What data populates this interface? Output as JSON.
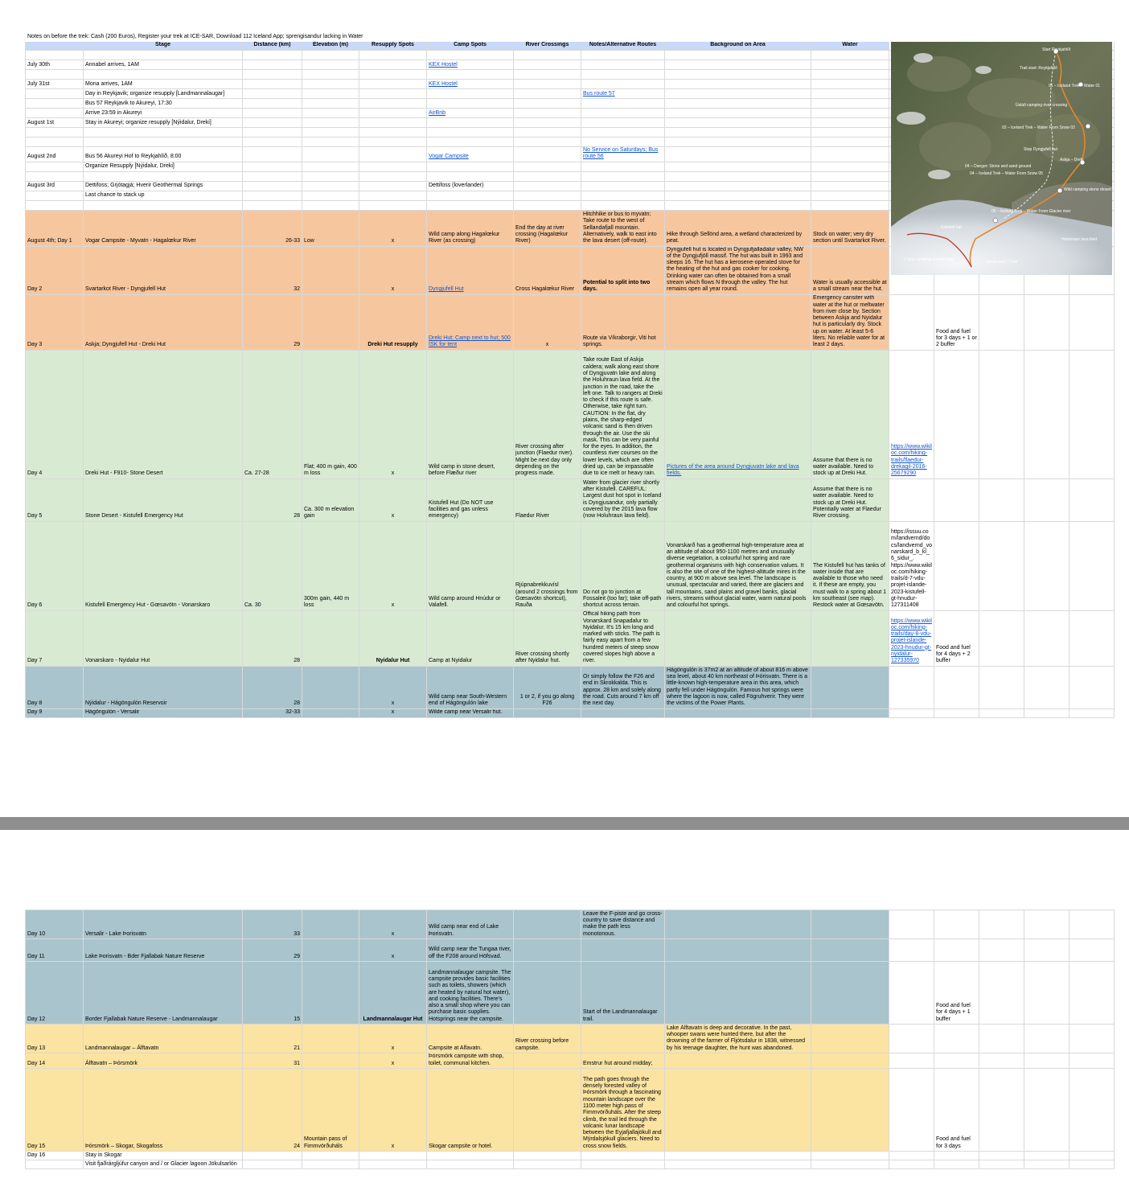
{
  "notes": "Notes on before the trek: Cash (200 Euros), Register your trek at ICE-SAR, Download 112 Iceland App; sprengisandur lacking in Water",
  "headers": [
    "",
    "Stage",
    "Distance (km)",
    "Elevation (m)",
    "Resupply Spots",
    "Camp Spots",
    "River Crossings",
    "Notes/Alternative Routes",
    "Background on Area",
    "Water"
  ],
  "pre": {
    "r1": {
      "date": "July 30th",
      "stage": "Annabel arrives, 1AM",
      "camp": "KEX Hostel"
    },
    "r2": {
      "date": "July 31st",
      "stage": "Mona arrives, 1AM",
      "camp": "KEX Hostel"
    },
    "r3": {
      "stage": "Day in Reykjavik; organize resupply [Landmannalaugar]",
      "notes": "Bus route 57"
    },
    "r4": {
      "stage": "Bus 57 Reykjavik to Akureyi, 17:30"
    },
    "r5": {
      "stage": "Arrive 23:59 in Akureyi",
      "camp": "AirBnb"
    },
    "r6": {
      "date": "August 1st",
      "stage": "Stay in Akureyi; organize resupply [Nýidalur, Dreki]"
    },
    "r7": {
      "date": "August 2nd",
      "stage": "Bus 56 Akureyi Hof to Reykjahlíð, 8:00",
      "camp": "Vogar Campsite",
      "notes": "No Service on Saturdays; Bus route 56"
    },
    "r8": {
      "stage": "Organize Resupply  [Nýidalur, Dreki]"
    },
    "r9": {
      "date": "August 3rd",
      "stage": "Dettifoss; Grjótagjá; Hverir Geothermal Springs",
      "camp": "Dettifoss (loverlander)"
    },
    "r10": {
      "stage": "Last chance to stack up"
    }
  },
  "days": {
    "d1": {
      "date": "August 4th; Day 1",
      "stage": "Vogar Campsite - Myvatn - Hagalœkur River",
      "dist": "26-33",
      "elev": "Low",
      "res": "x",
      "camp": "Wild camp along Hagalœkur River (as crossing)",
      "river": "End the day at river crossing (Hagalœkur River)",
      "notes": "Hitchhike or bus to myvatn; Take route to the west of Sellandafjall mountain. Alternatively, walk to east into the lava desert (off-route).",
      "bg": "Hike through Sellönd area, a wetland characterized by peat.",
      "water": "Stock on water; very dry section until Svartarkot River."
    },
    "d2": {
      "date": "Day 2",
      "stage": "Svartarkot River - Dyngjufell Hut",
      "dist": "32",
      "res": "x",
      "camp": "Dyngjufell Hut",
      "river": "Cross Hagalœkur River",
      "notes": "Potential to split into two days.",
      "bg": "Dyngjufell hut is located in Dyngjufjalladalur valley, NW of the Dyngjufjöll massif. The hut was built in 1993 and sleeps 16. The hut has a kerosene-operated stove for the heating of the hut and gas cooker for cooking. Drinking water can often be obtained from a small stream which flows N through the valley. The hut remains open all year round.",
      "water": "Water is usually accessible at a small stream near the hut."
    },
    "d3": {
      "date": "Day 3",
      "stage": "Askja; Dyngjufell Hut - Dreki Hut",
      "dist": "29",
      "res": "Dreki Hut resupply",
      "camp": "Dreki Hut; Camp next to hut; 500 ISK for tent",
      "river": "x",
      "notes": "Route via Víkraborgir, Viti hot springs.",
      "water": "Emergency cansiter with water at the hut or meltwater from river close by. Section between Askja and Nyidalur hut is particularly dry. Stock up on water. At least 5-6 liters. No reliable water for at least 2 days.",
      "food": "Food and fuel for 3 days + 1 or 2 buffer"
    },
    "d4": {
      "date": "Day 4",
      "stage": "Dreki Hut - F910- Stone Desert",
      "dist": "Ca. 27-28",
      "elev": "Flat; 400 m gain, 400 m loss",
      "res": "x",
      "camp": "Wild camp in stone desert, before Flæður river",
      "river": "River crossing after junction (Flaedur river). Might be next day only depending on the progress made.",
      "notes": "Take route East of Askja caldera; walk along east shore of Dyngjuvatn lake and along the Holuhraun lava field. At the junction in the road, take the left one. Talk to rangers at Dreki to check if this route is safe. Otherwise, take right turn. CAUTION: In the flat, dry plains, the sharp-edged volcanic sand is then driven through the air. Use the ski mask. This can be very painful for the eyes. In addition, the countless river courses on the lower levels, which are often dried up, can be impassable due to ice melt or heavy rain.",
      "bg": "Pictures of the area around Dyngjuvatn lake and lava fields.",
      "water": "Assume that there is no water available. Need to stock up at Dreki Hut.",
      "link": "https://www.wikiloc.com/hiking-trails/flaedur-drekagil-2016-25679290"
    },
    "d5": {
      "date": "Day 5",
      "stage": "Stone Desert - Kistufell Emergency Hut",
      "dist": "28",
      "elev": "Ca. 300 m elevation gain",
      "res": "x",
      "camp": "Kistufell Hut (Do NOT use facilities and gas unless emergency)",
      "river": "Flaedur River",
      "notes": "Water from glacier river shortly after Kistufell. CAREFUL: Largest dust hot spot in Iceland is Dyngjusandur, only partially covered by the 2015 lava flow (now Holuhraun lava field).",
      "water": "Assume that there is no water available. Need to stock up at Dreki Hut. Potentially water at Flaedur River crossing."
    },
    "d6": {
      "date": "Day 6",
      "stage": "Kistufell Emergency Hut - Gœsavötn - Vonarskaro",
      "dist": "Ca. 30",
      "elev": "300m gain, 440 m loss",
      "res": "x",
      "camp": "Wild camp around Hnúdur or Valafell.",
      "river": "Rjúpnabrekkuvísl (around 2 crossings from Gœsavötn shortcut), Rauða",
      "notes": "Do not go to junction at Fossaleit (too far); take off-path shortcut across terrain.",
      "bg": "Vonarskarð has a geothermal high-temperature area at an altitude of about 950-1100 metres and unusually diverse vegetation, a colourful hot spring and rare geothermal organisms with high conservation values. It is also the site of one of the highest-altitude mires in the country, at 900 m above sea level. The landscape is unusual, spectacular and varied, there are glaciers and tall mountains, sand plains and gravel banks, glacial rivers, streams without glacial water, warm natural pools and colourful hot springs.",
      "water": "The Kistufell hut has tanks of water inside that are available to those who need it. If these are empty, you must walk to a spring about 1 km southeast (see map). Restock water at Gœsavötn.",
      "link": "https://issuu.com/landvernd/docs/landvernd_vonarskard_b_kl_6_sidur_. https://www.wikiloc.com/hiking-trails/d-7-vdu-projet-islande-2023-kistufell-gt-hnudur-127311408"
    },
    "d7": {
      "date": "Day 7",
      "stage": "Vonarskaro - Nyidalur Hut",
      "dist": "28",
      "res": "Nyidalur Hut",
      "camp": "Camp at Nyidalur",
      "river": "River crossing shortly after Nyidalur hut.",
      "notes": "Offical hiking path from Vonarskard Snapadalur to Nyidalur. It's 15 km long and marked with sticks. The path is fairly easy apart from a few hundred meters of steep snow covered slopes high above a river.",
      "link": "https://www.wikiloc.com/hiking-trails/day-8-vdu-projet-islande-2023-hnudur-gt-nyidalur-127335970",
      "food": "Food and fuel for 4 days + 2 buffer"
    },
    "d8": {
      "date": "Day 8",
      "stage": "Nýidalur - Hágöngulón Reservoir",
      "dist": "28",
      "res": "x",
      "camp": "Wild camp near South-Western end of Hágöngulón lake",
      "river": "1 or 2, if you go along F26",
      "notes": "Or simply follow the F26 and end in Skrokkalda. This is approx. 28 km and solely along the road.  Cuts around 7 km off the next day.",
      "bg": "Hágöngulón is 37m2 at an altitude of about 816 m above sea level, about 40 km northeast of Þórisvatn. There is a little-known high-temperature area in this area, which partly fell under Hágöngulón. Famous hot springs were where the lagoon is now, called Fögruhverir. They were the victims of the Power Plants."
    },
    "d9": {
      "date": "Day 9",
      "stage": "Hágöngulón - Versalir",
      "dist": "32-33",
      "res": "x",
      "camp": "Wilde camp near Versalir hut."
    },
    "d10": {
      "date": "Day 10",
      "stage": "Versalir - Lake Þorisvatn",
      "dist": "33",
      "res": "x",
      "camp": "Wild camp near end of Lake Þorisvatn.",
      "notes": "Leave the F-piste and go cross-country to save distance and make the path less monotonous."
    },
    "d11": {
      "date": "Day 11",
      "stage": "Lake Þorisvatn - Bder Fjallabak Nature Reserve",
      "dist": "29",
      "res": "x",
      "camp": "Wild camp near the Tungaa river, off the F208 around Höfsvad."
    },
    "d12": {
      "date": "Day 12",
      "stage": "Border Fjallabak Nature Reserve - Landmannalaugar",
      "dist": "15",
      "res": "Landmannalaugar Hut",
      "camp": "Landmannalaugar campsite. The campsite provides basic facilities such as toilets, showers (which are heated by natural hot water), and cooking facilities. There's also a small shop where you can purchase basic supplies. Hotsprings near the campsite.",
      "notes": "Start of the Landmannalaugar trail.",
      "food": "Food and fuel for 4 days + 1 buffer"
    },
    "d13": {
      "date": "Day 13",
      "stage": "Landmannalaugar – Álftavatn",
      "dist": "21",
      "res": "x",
      "camp": "Campsite at Alfavatn.",
      "river": "River crossing before campsite.",
      "bg": "Lake Álftavatn is deep and decorative. In the past, whooper swans were hunted there, but after the drowning of the farmer of Fljótsdalur in 1838, witnessed by his teenage daughter, the hunt was abandoned."
    },
    "d14": {
      "date": "Day 14",
      "stage": "Álftavatn – Þórsmörk",
      "dist": "31",
      "res": "x",
      "camp": "Þórsmörk campsite with shop, toilet, communal kitchen.",
      "notes": "Emstrur hut around midday;"
    },
    "d15": {
      "date": "Day 15",
      "stage": "Þórsmörk – Skogar, Skogafoss",
      "dist": "24",
      "elev": "Mountain pass of Fimmvörðuháls",
      "res": "x",
      "camp": "Skogar campsite or hotel.",
      "notes": "The path goes through the densely forested valley of Þórsmörk through a fascinating mountain landscape over the 1100 meter high pass of Fimmvörðuháls. After the steep climb, the trail led through the volcanic lunar landscape between the Eyjafjallajökull and Mýrdalsjökull glaciers. Need to cross snow fields.",
      "food": "Food and fuel for 3 days"
    },
    "d16": {
      "date": "Day 16",
      "stage": "Stay in Skogar"
    },
    "d17": {
      "stage": "Visit  fjaðrárgljúfur canyon and / or Glacier lagoon Jökulsarlón"
    }
  },
  "map": {
    "labels": [
      "Start Reykjahlíð",
      "Trail start: Reykjahlíð",
      "01 – Iceland Trek – Water 01",
      "Úsláð camping river crossing",
      "02 – Iceland Trek – Water From Snow 02",
      "Stop Dyngjufell hut",
      "Askja – Dreki",
      "04 – Danger: Stone and sand ground",
      "04 – Iceland Trek – Water From Snow 05",
      "Wild camping stone desert",
      "05 – Iceland Trek – Water From Glacier river",
      "Holuhraun lava field",
      "Kistufell hut",
      "2 stop camping around here",
      "Vonarskarð / Trail"
    ],
    "colors": {
      "route": "#e8872a",
      "path": "#ffffff",
      "glacier": "#e9edf0",
      "terrain": "#5d6a4a"
    }
  },
  "colors": {
    "header": "#c9daf8",
    "orange": "#f6c79f",
    "green": "#d9ead3",
    "blue": "#a9c4cc",
    "yellow": "#fbe3a2",
    "link": "#1155cc"
  }
}
